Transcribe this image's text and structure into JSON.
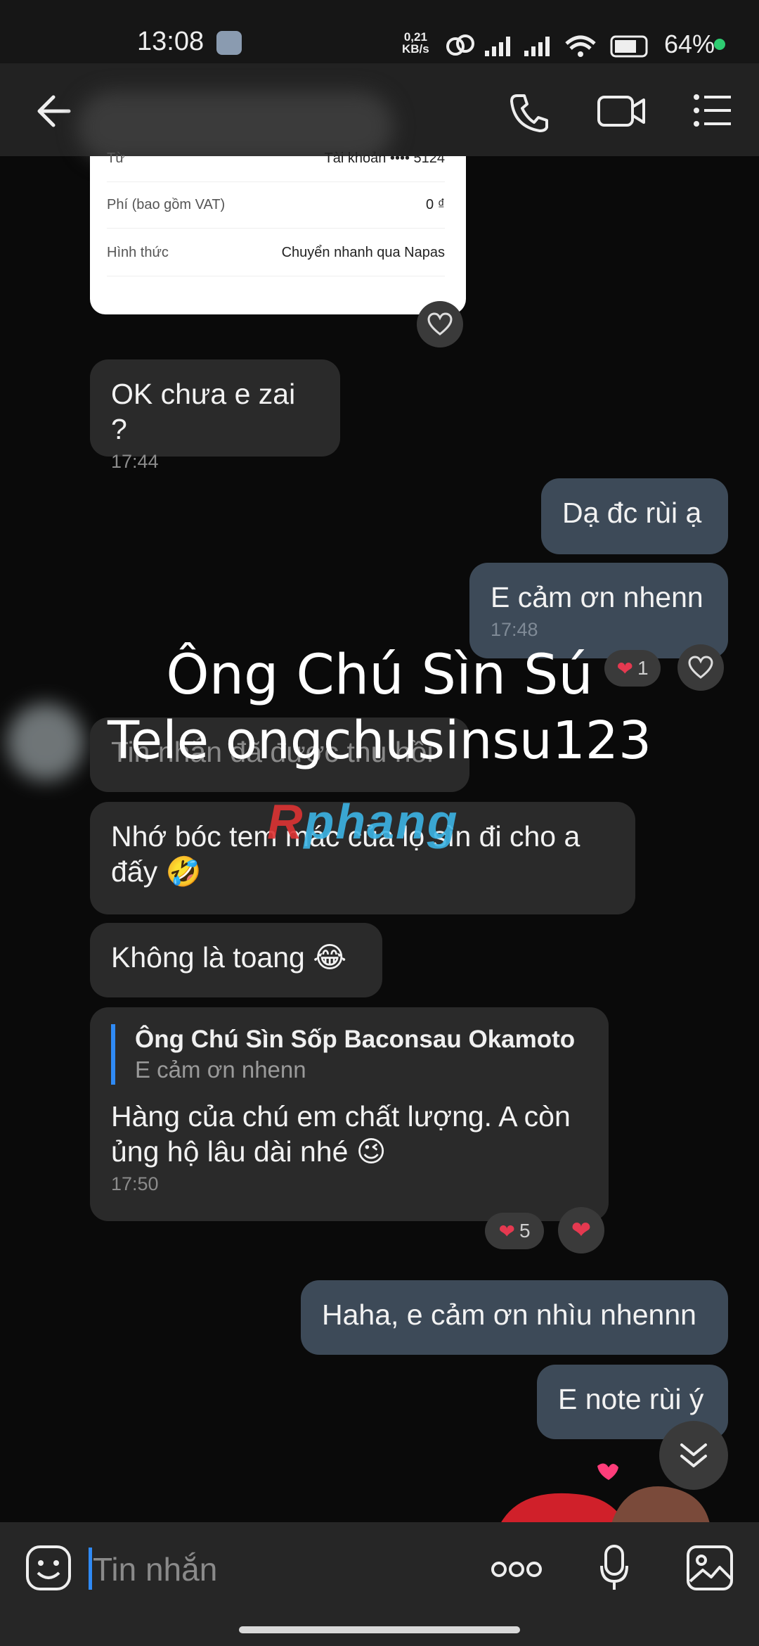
{
  "status_bar": {
    "time": "13:08",
    "net_speed": "0,21",
    "net_unit": "KB/s",
    "battery": "64%"
  },
  "header": {
    "contact_name": ""
  },
  "screenshot_card": {
    "rows": [
      {
        "label": "Từ",
        "value": "Tài khoản •••• 5124"
      },
      {
        "label": "Phí (bao gồm VAT)",
        "value": "0 ₫"
      },
      {
        "label": "Hình thức",
        "value": "Chuyển nhanh qua Napas"
      }
    ]
  },
  "messages": [
    {
      "text": "OK chưa e zai ?",
      "time": "17:44"
    },
    {
      "text": "Dạ đc rùi ạ"
    },
    {
      "text": "E cảm ơn nhenn",
      "time": "17:48",
      "reaction_count": "1"
    },
    {
      "text": "Tin nhắn đã được thu hồi"
    },
    {
      "text": "Nhớ bóc tem mác của lọ sìn đi cho a đấy 🤣"
    },
    {
      "text": "Không là toang 😂"
    },
    {
      "quote_name": "Ông Chú Sìn Sốp Baconsau Okamoto",
      "quote_text": "E cảm ơn nhenn",
      "text": "Hàng của chú em chất lượng. A còn ủng hộ lâu dài nhé 😉",
      "time": "17:50",
      "reaction_count": "5"
    },
    {
      "text": "Haha, e cảm ơn nhìu nhennn"
    },
    {
      "text": "E note rùi ý"
    }
  ],
  "watermark": {
    "line1": "Ông Chú Sìn Sú",
    "line2": "Tele ongchusinsu123",
    "logo_a": "R",
    "logo_b": "phang"
  },
  "composer": {
    "placeholder": "Tin nhắn"
  },
  "icons": {
    "back": "arrow-left-icon",
    "call": "phone-icon",
    "video": "video-icon",
    "menu": "list-menu-icon",
    "sticker": "sticker-icon",
    "more": "more-dots-icon",
    "mic": "microphone-icon",
    "image": "image-icon",
    "scroll": "chevron-down-double-icon"
  },
  "colors": {
    "outgoing_bubble": "#3d4a58",
    "incoming_bubble": "#2a2a2a",
    "accent": "#2f8af5",
    "heart": "#e53950"
  }
}
